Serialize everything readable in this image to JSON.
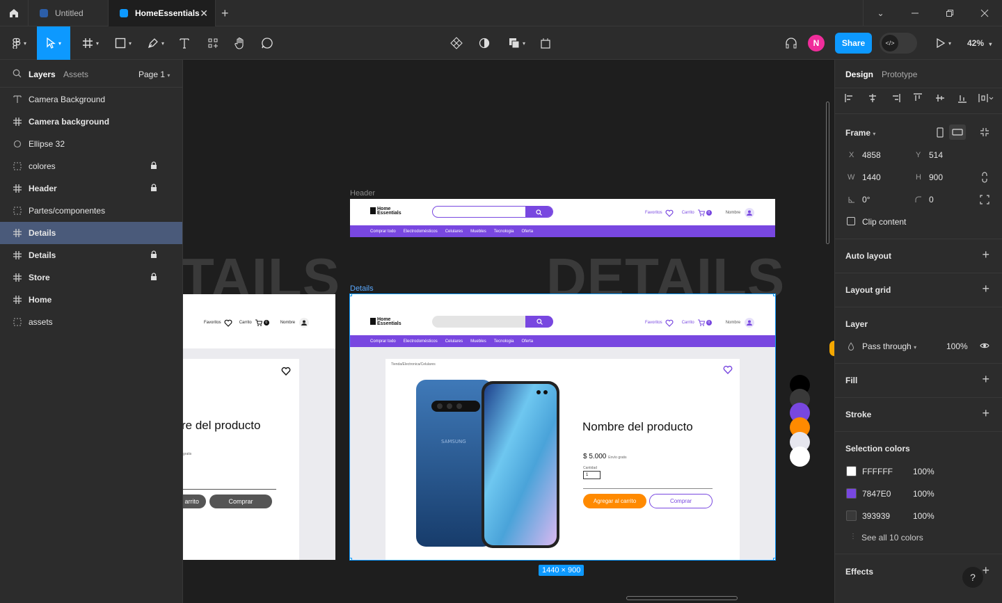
{
  "tabs": {
    "items": [
      {
        "label": "Untitled"
      },
      {
        "label": "HomeEssentials"
      }
    ]
  },
  "toolbar": {
    "share_label": "Share",
    "zoom_label": "42%",
    "avatar_initial": "N"
  },
  "left_panel": {
    "tab_layers": "Layers",
    "tab_assets": "Assets",
    "page_label": "Page 1",
    "layers": [
      {
        "label": "Camera Background",
        "icon": "text-icon",
        "bold": false,
        "locked": false
      },
      {
        "label": "Camera background",
        "icon": "frame-icon",
        "bold": true,
        "locked": false
      },
      {
        "label": "Ellipse 32",
        "icon": "ellipse-icon",
        "bold": false,
        "locked": false
      },
      {
        "label": "colores",
        "icon": "section-icon",
        "bold": false,
        "locked": true
      },
      {
        "label": "Header",
        "icon": "frame-icon",
        "bold": true,
        "locked": true
      },
      {
        "label": "Partes/componentes",
        "icon": "section-icon",
        "bold": false,
        "locked": false
      },
      {
        "label": "Details",
        "icon": "frame-icon",
        "bold": true,
        "locked": false,
        "selected": true
      },
      {
        "label": "Details",
        "icon": "frame-icon",
        "bold": true,
        "locked": true
      },
      {
        "label": "Store",
        "icon": "frame-icon",
        "bold": true,
        "locked": true
      },
      {
        "label": "Home",
        "icon": "frame-icon",
        "bold": true,
        "locked": false
      },
      {
        "label": "assets",
        "icon": "section-icon",
        "bold": false,
        "locked": false
      }
    ]
  },
  "canvas": {
    "header_frame_label": "Header",
    "details_frame_label": "Details",
    "big_text_left": "TAILS",
    "big_text_right": "DETAILS",
    "size_badge": "1440 × 900",
    "site": {
      "logo_line1": "Home",
      "logo_line2": "Essentials",
      "favoritos": "Favoritos",
      "carrito": "Carrito",
      "cart_count": "0",
      "nombre": "Nombre",
      "nav": [
        "Comprar todo",
        "Electrodomésticos",
        "Celulares",
        "Muebles",
        "Tecnologia",
        "Oferta"
      ],
      "breadcrumb": "Tienda/Electronica/Celulares",
      "product_name": "Nombre del producto",
      "product_name_partial": "re del producto",
      "price": "$ 5.000",
      "shipping": "Envío gratis",
      "shipping_partial": "gratis",
      "quantity_label": "Cantidad",
      "quantity_value": "1",
      "add_to_cart": "Agregar al carrito",
      "add_to_cart_partial": "arrito",
      "buy": "Comprar",
      "phone_brand": "SAMSUNG"
    },
    "palette": [
      "#000000",
      "#393939",
      "#7847e0",
      "#ff8a00",
      "#e6e6ee",
      "#ffffff"
    ]
  },
  "right_panel": {
    "tab_design": "Design",
    "tab_prototype": "Prototype",
    "frame_title": "Frame",
    "x_label": "X",
    "x_value": "4858",
    "y_label": "Y",
    "y_value": "514",
    "w_label": "W",
    "w_value": "1440",
    "h_label": "H",
    "h_value": "900",
    "rotation": "0°",
    "radius": "0",
    "clip_content": "Clip content",
    "auto_layout": "Auto layout",
    "layout_grid": "Layout grid",
    "layer_title": "Layer",
    "blend_mode": "Pass through",
    "layer_opacity": "100%",
    "fill": "Fill",
    "stroke": "Stroke",
    "selection_colors": "Selection colors",
    "colors": [
      {
        "hex": "FFFFFF",
        "opacity": "100%",
        "swatch": "#ffffff"
      },
      {
        "hex": "7847E0",
        "opacity": "100%",
        "swatch": "#7847e0"
      },
      {
        "hex": "393939",
        "opacity": "100%",
        "swatch": "#393939"
      }
    ],
    "see_all": "See all 10 colors",
    "effects": "Effects",
    "help": "?"
  }
}
